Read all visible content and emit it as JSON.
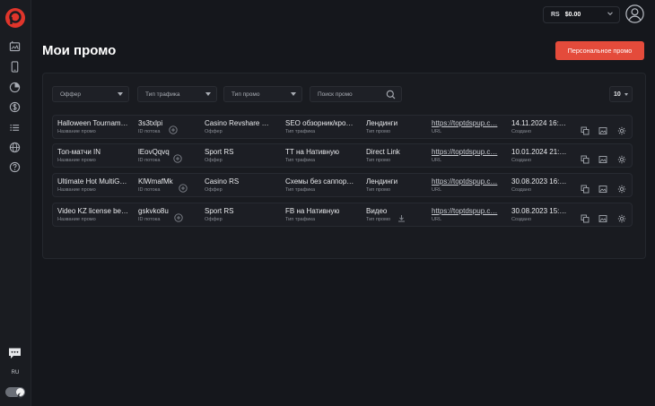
{
  "topbar": {
    "currency": "RS",
    "balance": "$0.00"
  },
  "page": {
    "title": "Мои промо",
    "create_button": "Персональное промо"
  },
  "filters": {
    "offer": "Оффер",
    "traffic_type": "Тип трафика",
    "promo_type": "Тип промо",
    "search_placeholder": "Поиск промо",
    "page_size": "10"
  },
  "labels": {
    "name": "Название промо",
    "stream_id": "ID потока",
    "offer": "Оффер",
    "traffic_type": "Тип трафика",
    "promo_type": "Тип промо",
    "url": "URL",
    "created": "Создано"
  },
  "rows": [
    {
      "name": "Halloween Tournam…",
      "stream_id": "3s3txlpi",
      "offer": "Casino Revshare U…",
      "traffic_type": "SEO обзорник/кро…",
      "promo_type": "Лендинги",
      "url": "https://toptdspup.c…",
      "created": "14.11.2024 16:…"
    },
    {
      "name": "Топ-матчи IN",
      "stream_id": "lEovQqvq",
      "offer": "Sport RS",
      "traffic_type": "ТТ на Нативную",
      "promo_type": "Direct Link",
      "url": "https://toptdspup.c…",
      "created": "10.01.2024 21:…"
    },
    {
      "name": "Ultimate Hot MultiG…",
      "stream_id": "KlWmafMk",
      "offer": "Casino RS",
      "traffic_type": "Схемы без саппор…",
      "promo_type": "Лендинги",
      "url": "https://toptdspup.c…",
      "created": "30.08.2023 16:…"
    },
    {
      "name": "Video KZ license be…",
      "stream_id": "gskvko8u",
      "offer": "Sport RS",
      "traffic_type": "FB на Нативную",
      "promo_type": "Видео",
      "url": "https://toptdspup.c…",
      "created": "30.08.2023 15:…"
    }
  ],
  "sidebar": {
    "icons": [
      "promo-icon",
      "mobile-icon",
      "pie-chart-icon",
      "dollar-icon",
      "list-icon",
      "globe-icon",
      "help-icon"
    ],
    "language": "RU"
  },
  "colors": {
    "background": "#15171c",
    "accent": "#e44b3b",
    "logo": "#e0352b"
  }
}
